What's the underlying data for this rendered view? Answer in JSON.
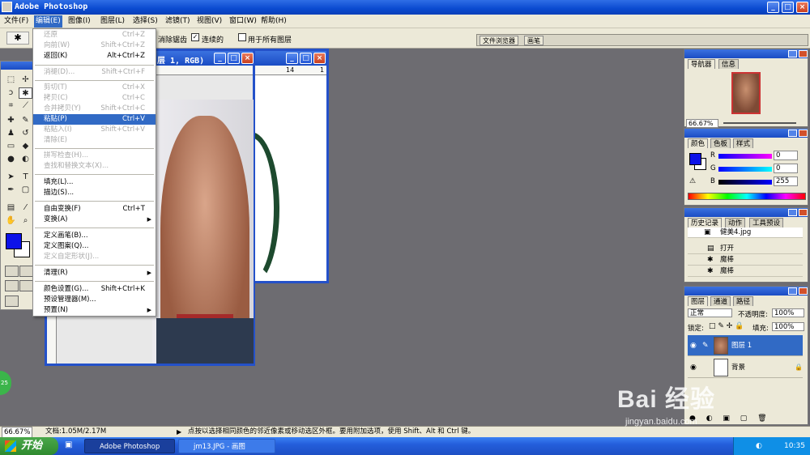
{
  "window": {
    "title": "Adobe Photoshop"
  },
  "menu": {
    "file": "文件(F)",
    "edit": "编辑(E)",
    "image": "图像(I)",
    "layer": "图层(L)",
    "select": "选择(S)",
    "filter": "滤镜(T)",
    "view": "视图(V)",
    "window": "窗口(W)",
    "help": "帮助(H)"
  },
  "options": {
    "antialias": "消除锯齿",
    "contiguous": "连续的",
    "all_layers": "用于所有图层",
    "tab_file_browser": "文件浏览器",
    "tab_brushes": "画笔"
  },
  "document": {
    "title_fragment": "层 1, RGB)",
    "ruler_14": "14",
    "ruler_1": "1"
  },
  "edit_menu": {
    "undo": {
      "label": "还原",
      "shortcut": "Ctrl+Z"
    },
    "step_forward": {
      "label": "向前(W)",
      "shortcut": "Shift+Ctrl+Z"
    },
    "step_backward": {
      "label": "返回(K)",
      "shortcut": "Alt+Ctrl+Z"
    },
    "fade": {
      "label": "消褪(D)...",
      "shortcut": "Shift+Ctrl+F"
    },
    "cut": {
      "label": "剪切(T)",
      "shortcut": "Ctrl+X"
    },
    "copy": {
      "label": "拷贝(C)",
      "shortcut": "Ctrl+C"
    },
    "copy_merged": {
      "label": "合并拷贝(Y)",
      "shortcut": "Shift+Ctrl+C"
    },
    "paste": {
      "label": "粘贴(P)",
      "shortcut": "Ctrl+V"
    },
    "paste_into": {
      "label": "粘贴入(I)",
      "shortcut": "Shift+Ctrl+V"
    },
    "clear": {
      "label": "清除(E)"
    },
    "spell_check": {
      "label": "拼写检查(H)..."
    },
    "find_replace": {
      "label": "查找和替换文本(X)..."
    },
    "fill": {
      "label": "填充(L)..."
    },
    "stroke": {
      "label": "描边(S)..."
    },
    "free_transform": {
      "label": "自由变换(F)",
      "shortcut": "Ctrl+T"
    },
    "transform": {
      "label": "变换(A)"
    },
    "define_brush": {
      "label": "定义画笔(B)..."
    },
    "define_pattern": {
      "label": "定义图案(Q)..."
    },
    "define_shape": {
      "label": "定义自定形状(J)..."
    },
    "purge": {
      "label": "清理(R)"
    },
    "color_settings": {
      "label": "颜色设置(G)...",
      "shortcut": "Shift+Ctrl+K"
    },
    "preset_manager": {
      "label": "预设管理器(M)..."
    },
    "preferences": {
      "label": "预置(N)"
    }
  },
  "navigator": {
    "tab_nav": "导航器",
    "tab_info": "信息",
    "zoom": "66.67%"
  },
  "color_panel": {
    "tab_color": "颜色",
    "tab_swatches": "色板",
    "tab_styles": "样式",
    "r_label": "R",
    "g_label": "G",
    "b_label": "B",
    "r": "0",
    "g": "0",
    "b": "255",
    "fg_color": "#0c12e8"
  },
  "history": {
    "tab_history": "历史记录",
    "tab_actions": "动作",
    "tab_presets": "工具预设",
    "snapshot": "健美4.jpg",
    "steps": [
      "打开",
      "魔棒",
      "魔棒"
    ]
  },
  "layers": {
    "tab_layers": "图层",
    "tab_channels": "通道",
    "tab_paths": "路径",
    "blend_mode": "正常",
    "opacity_label": "不透明度:",
    "opacity": "100%",
    "lock_label": "锁定:",
    "fill_label": "填充:",
    "fill": "100%",
    "items": [
      "图层 1",
      "背景"
    ]
  },
  "status": {
    "zoom": "66.67%",
    "doc": "文档:1.05M/2.17M",
    "hint": "点按以选择相同颜色的邻近像素或移动选区外框。要用附加选项，使用 Shift、Alt 和 Ctrl 键。"
  },
  "taskbar": {
    "start": "开始",
    "tasks": [
      "Adobe Photoshop",
      "jm13.JPG - 画图"
    ],
    "time": "10:35"
  },
  "watermark": {
    "main": "Bai 经验",
    "url": "jingyan.baidu.com"
  },
  "side_badge": "25"
}
